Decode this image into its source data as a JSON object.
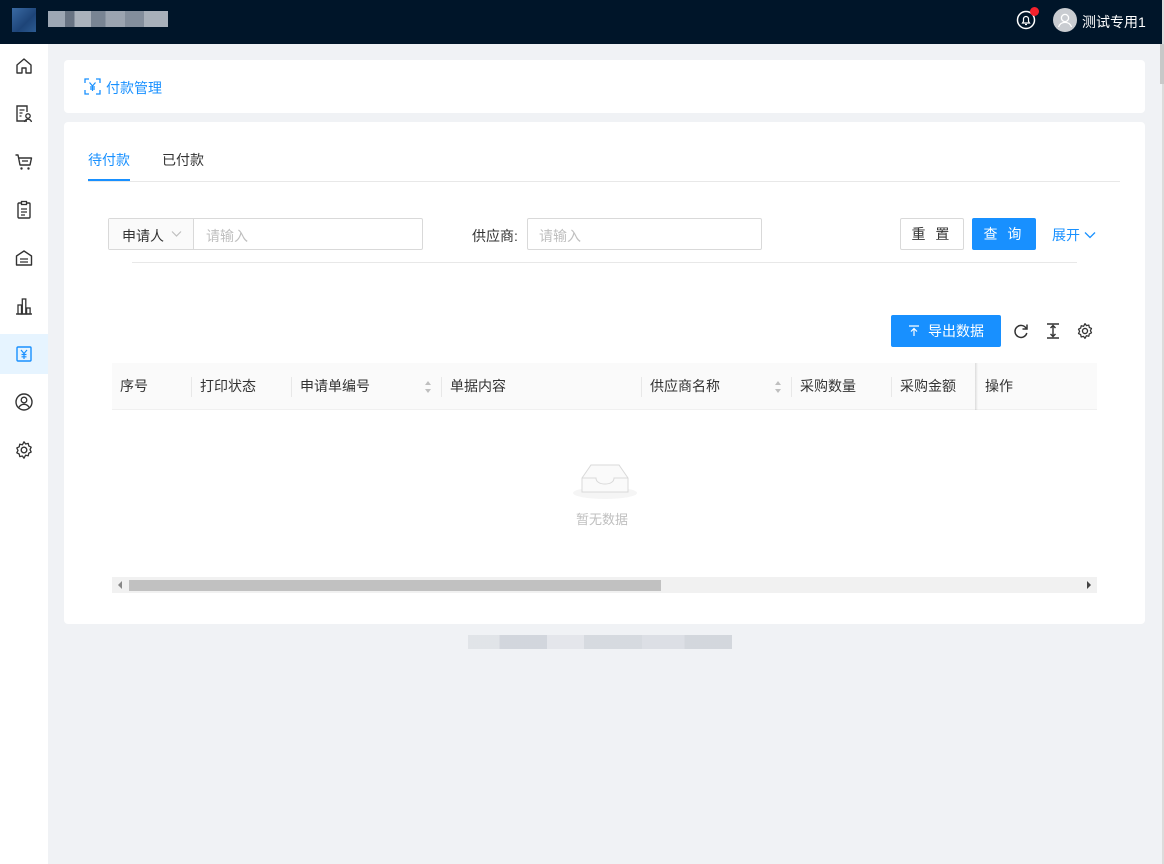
{
  "header": {
    "user_name": "测试专用1",
    "notification_icon": "bell-icon",
    "avatar_icon": "user-avatar-icon"
  },
  "sidebar": {
    "items": [
      {
        "icon": "home-icon",
        "active": false
      },
      {
        "icon": "document-user-icon",
        "active": false
      },
      {
        "icon": "cart-icon",
        "active": false
      },
      {
        "icon": "clipboard-icon",
        "active": false
      },
      {
        "icon": "warehouse-icon",
        "active": false
      },
      {
        "icon": "bar-chart-icon",
        "active": false
      },
      {
        "icon": "yen-icon",
        "active": true
      },
      {
        "icon": "user-circle-icon",
        "active": false
      },
      {
        "icon": "gear-icon",
        "active": false
      }
    ]
  },
  "breadcrumb": {
    "icon": "yen-icon",
    "title": "付款管理"
  },
  "tabs": [
    {
      "label": "待付款",
      "active": true
    },
    {
      "label": "已付款",
      "active": false
    }
  ],
  "filters": {
    "applicant_select": "申请人",
    "applicant_placeholder": "请输入",
    "supplier_label": "供应商:",
    "supplier_placeholder": "请输入",
    "reset_label": "重 置",
    "query_label": "查 询",
    "expand_label": "展开"
  },
  "toolbar": {
    "export_label": "导出数据",
    "icons": [
      "refresh-icon",
      "column-height-icon",
      "settings-icon"
    ]
  },
  "table": {
    "columns": [
      "序号",
      "打印状态",
      "申请单编号",
      "单据内容",
      "供应商名称",
      "采购数量",
      "采购金额",
      "操作"
    ],
    "rows": [],
    "empty_text": "暂无数据"
  },
  "colors": {
    "primary": "#1890ff",
    "header_bg": "#001529",
    "badge": "#f5222d"
  }
}
